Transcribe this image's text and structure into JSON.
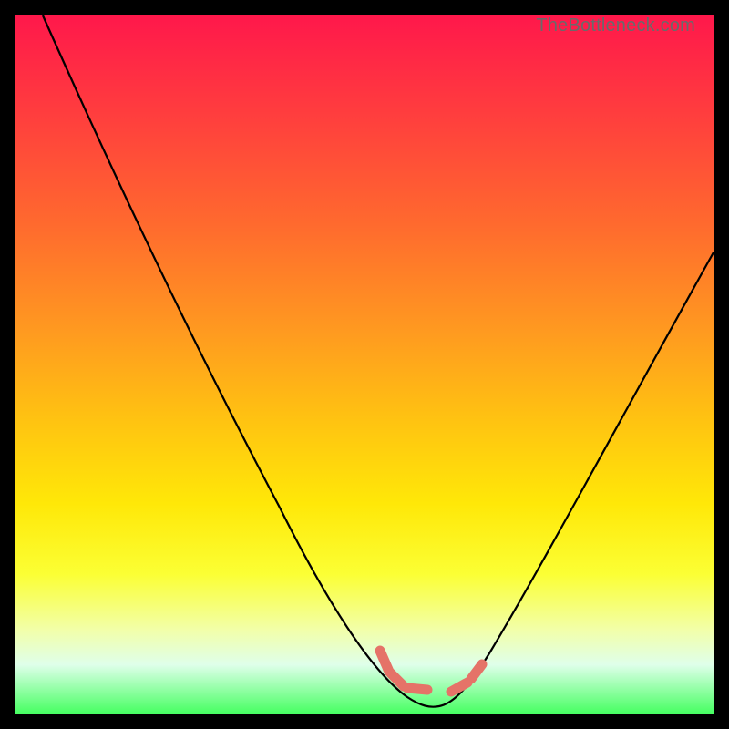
{
  "credit_text": "TheBottleneck.com",
  "colors": {
    "background": "#000000",
    "curve_stroke": "#000000",
    "marker_fill": "#e57368",
    "gradient_stops": [
      "#ff184b",
      "#ff3d3e",
      "#ff6a2e",
      "#ff9920",
      "#ffc311",
      "#ffe808",
      "#fbff34",
      "#f2ffa9",
      "#dfffea",
      "#47ff62"
    ]
  },
  "chart_data": {
    "type": "line",
    "title": "",
    "xlabel": "",
    "ylabel": "",
    "xlim": [
      0,
      100
    ],
    "ylim": [
      0,
      100
    ],
    "note": "Axis values are normalized 0–100 (left-to-right, bottom-to-top) estimated from pixel positions; no numeric labels are shown in the source image.",
    "series": [
      {
        "name": "bottleneck-curve",
        "x": [
          4,
          10,
          15,
          20,
          25,
          30,
          35,
          40,
          45,
          50,
          55,
          57,
          60,
          62,
          65,
          70,
          75,
          80,
          85,
          90,
          95,
          100
        ],
        "y": [
          100,
          90,
          82,
          73,
          64,
          55,
          46,
          37,
          28,
          19,
          10,
          5,
          2,
          2,
          5,
          12,
          21,
          30,
          40,
          49,
          58,
          66
        ]
      }
    ],
    "markers": [
      {
        "name": "left-marker-group",
        "description": "pink L-shaped marker cluster at valley left side",
        "points": [
          {
            "x": 52,
            "y": 9
          },
          {
            "x": 53.5,
            "y": 6
          },
          {
            "x": 55.5,
            "y": 4
          },
          {
            "x": 58,
            "y": 3.5
          }
        ]
      },
      {
        "name": "right-marker-group",
        "description": "pink short dash markers at valley right side",
        "points": [
          {
            "x": 62,
            "y": 3
          },
          {
            "x": 64.5,
            "y": 4
          },
          {
            "x": 66,
            "y": 6
          }
        ]
      }
    ],
    "curve_minimum": {
      "x": 60,
      "y": 2
    }
  }
}
